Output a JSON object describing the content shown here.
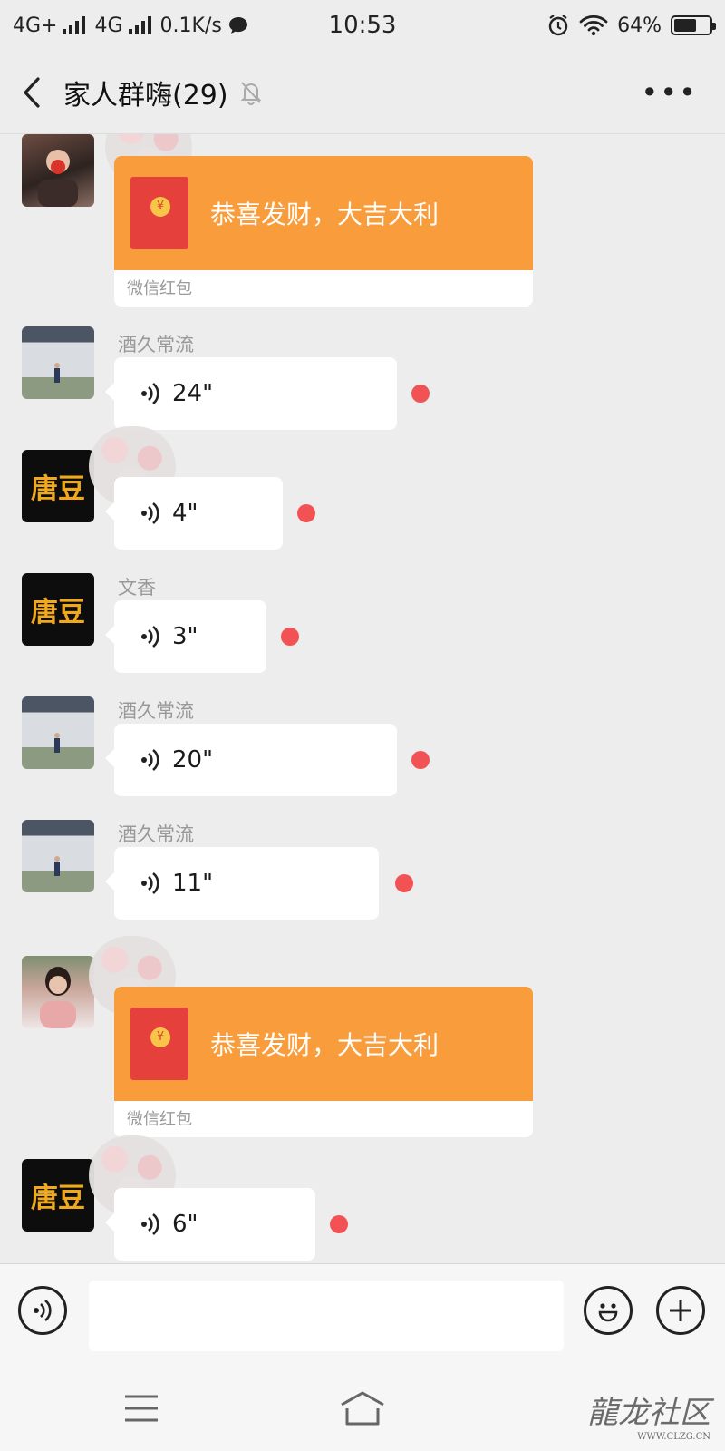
{
  "status_bar": {
    "network1": "4G+",
    "network2": "4G",
    "speed": "0.1K/s",
    "time": "10:53",
    "battery": "64%",
    "battery_level": 0.64
  },
  "nav": {
    "title": "家人群嗨(29)"
  },
  "messages": {
    "red1": {
      "text": "恭喜发财，大吉大利",
      "footer": "微信红包"
    },
    "v1": {
      "sender": "酒久常流",
      "duration": "24\""
    },
    "v2": {
      "duration": "4\""
    },
    "v3": {
      "sender": "文香",
      "duration": "3\""
    },
    "v4": {
      "sender": "酒久常流",
      "duration": "20\""
    },
    "v5": {
      "sender": "酒久常流",
      "duration": "11\""
    },
    "red2": {
      "text": "恭喜发财，大吉大利",
      "footer": "微信红包"
    },
    "v6": {
      "duration": "6\""
    }
  },
  "avatars": {
    "tang_glyph": "唐豆"
  },
  "watermark": {
    "text": "龍龙社区",
    "url": "WWW.CLZG.CN"
  },
  "colors": {
    "red_packet": "#f89c3c",
    "unread_dot": "#f25253",
    "background": "#ededed"
  },
  "icons": [
    "back-icon",
    "mute-bell-icon",
    "more-icon",
    "voice-icon",
    "emoji-icon",
    "plus-icon",
    "menu-icon",
    "home-icon"
  ]
}
